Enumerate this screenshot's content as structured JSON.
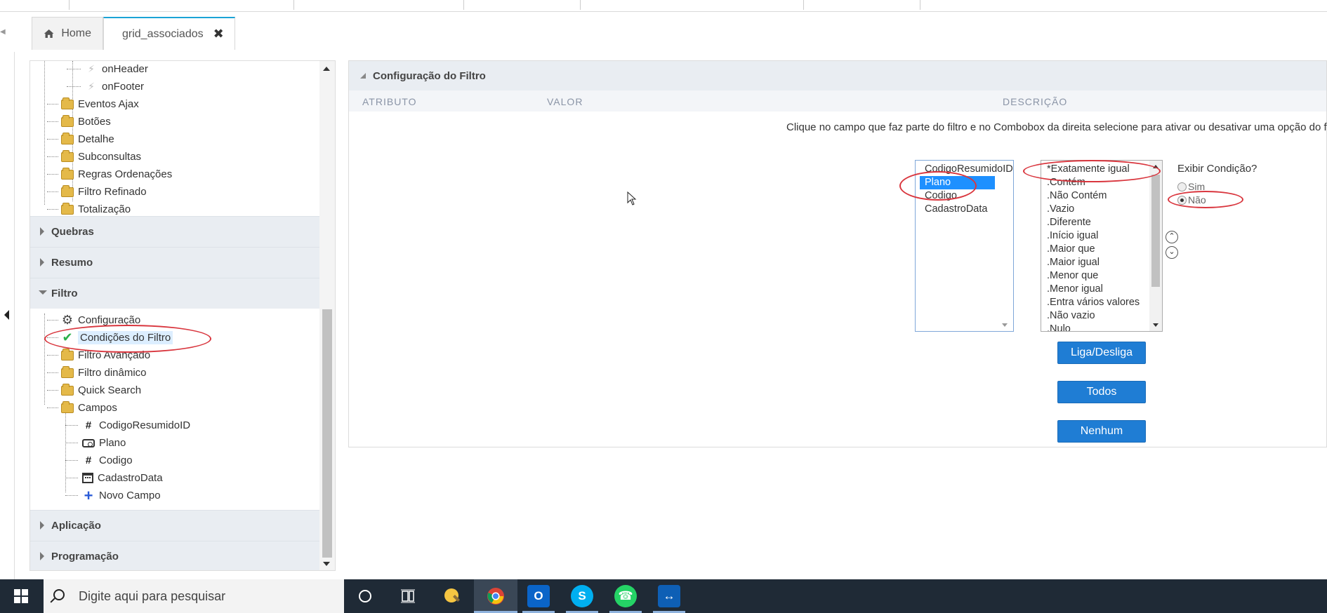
{
  "tabs": [
    {
      "label": "Home",
      "icon": "home-icon"
    },
    {
      "label": "grid_associados",
      "icon": "grid-table-icon"
    }
  ],
  "tree": {
    "events_items": [
      {
        "label": "onHeader",
        "icon": "bolt-icon"
      },
      {
        "label": "onFooter",
        "icon": "bolt-icon"
      }
    ],
    "folders_top": [
      {
        "label": "Eventos Ajax"
      },
      {
        "label": "Botões"
      },
      {
        "label": "Detalhe"
      },
      {
        "label": "Subconsultas"
      },
      {
        "label": "Regras Ordenações"
      },
      {
        "label": "Filtro Refinado"
      },
      {
        "label": "Totalização"
      }
    ],
    "sections": {
      "quebras": "Quebras",
      "resumo": "Resumo",
      "filtro": "Filtro",
      "aplicacao": "Aplicação",
      "programacao": "Programação"
    },
    "filtro_items": [
      {
        "label": "Configuração",
        "icon": "gear-icon"
      },
      {
        "label": "Condições do Filtro",
        "icon": "check-icon",
        "selected": true
      },
      {
        "label": "Filtro Avançado",
        "icon": "folder-icon"
      },
      {
        "label": "Filtro dinâmico",
        "icon": "folder-icon"
      },
      {
        "label": "Quick Search",
        "icon": "folder-icon"
      },
      {
        "label": "Campos",
        "icon": "folder-icon"
      }
    ],
    "campos_items": [
      {
        "label": "CodigoResumidoID",
        "icon": "hash-icon"
      },
      {
        "label": "Plano",
        "icon": "combo-icon"
      },
      {
        "label": "Codigo",
        "icon": "hash-icon"
      },
      {
        "label": "CadastroData",
        "icon": "calendar-icon"
      },
      {
        "label": "Novo Campo",
        "icon": "plus-icon"
      }
    ]
  },
  "config": {
    "title": "Configuração do Filtro",
    "columns": {
      "atributo": "ATRIBUTO",
      "valor": "VALOR",
      "descricao": "DESCRIÇÃO"
    },
    "description": "Clique no campo que faz parte do filtro e no Combobox da direita selecione para ativar ou desativar uma opção do f",
    "fields": [
      "CodigoResumidoID",
      "Plano",
      "Codigo",
      "CadastroData"
    ],
    "selected_field": "Plano",
    "conditions": [
      "*Exatamente igual",
      ".Contém",
      ".Não Contém",
      ".Vazio",
      ".Diferente",
      ".Início igual",
      ".Maior que",
      ".Maior igual",
      ".Menor que",
      ".Menor igual",
      ".Entra vários valores",
      ".Não vazio",
      ".Nulo"
    ],
    "show_condition_label": "Exibir Condição?",
    "radio_yes": "Sim",
    "radio_no": "Não",
    "radio_selected": "Não",
    "buttons": {
      "toggle": "Liga/Desliga",
      "all": "Todos",
      "none": "Nenhum"
    }
  },
  "taskbar": {
    "search_placeholder": "Digite aqui para pesquisar",
    "apps": [
      "cortana-icon",
      "task-view-icon",
      "paint-icon",
      "chrome-icon",
      "outlook-icon",
      "skype-icon",
      "whatsapp-icon",
      "teamviewer-icon"
    ]
  },
  "colors": {
    "accent_blue": "#1f7dd4",
    "selection_blue": "#1e90ff",
    "annotation_red": "#d9363e",
    "section_bg": "#e9edf2",
    "taskbar_bg": "#1f2a36"
  }
}
